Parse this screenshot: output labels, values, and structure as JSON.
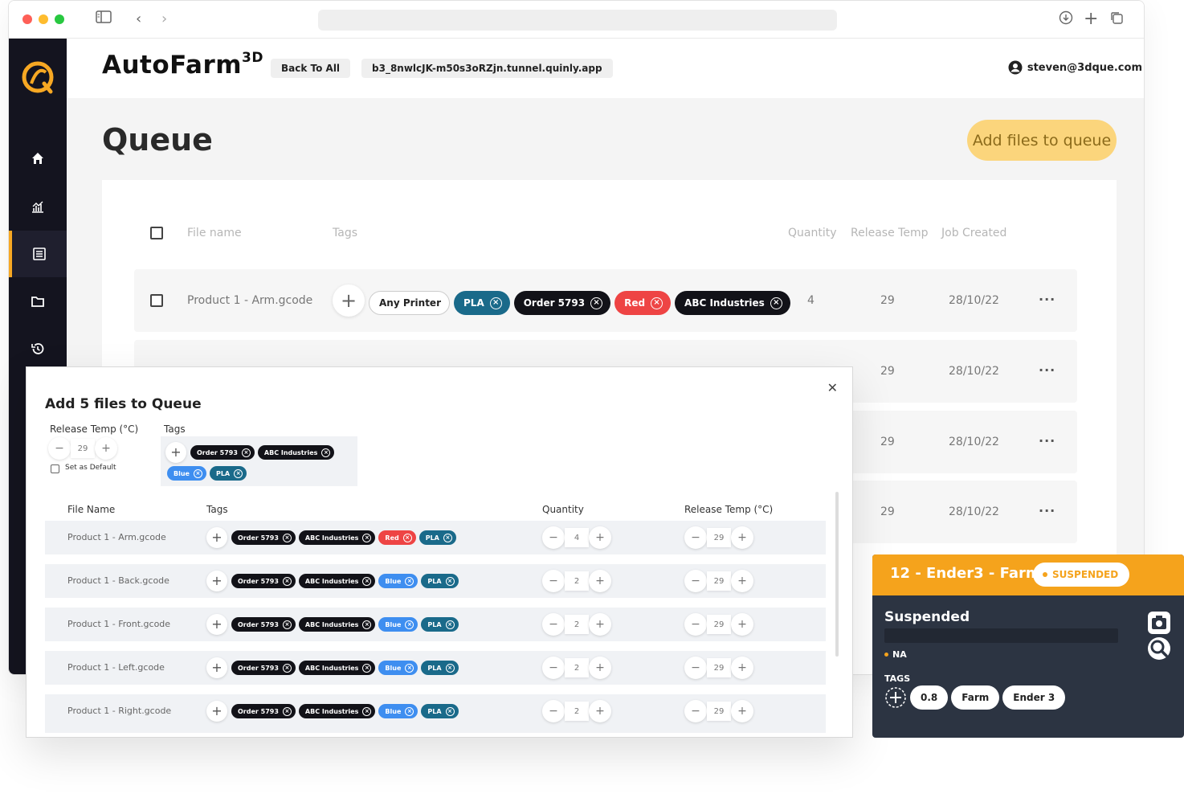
{
  "app": {
    "brand": "AutoFarm",
    "brand_sup": "3D",
    "back_label": "Back To All",
    "tunnel": "b3_8nwlcJK-m50s3oRZjn.tunnel.quinly.app",
    "user_email": "steven@3dque.com"
  },
  "queue": {
    "title": "Queue",
    "add_files_label": "Add files to queue",
    "headers": {
      "file_name": "File name",
      "tags": "Tags",
      "quantity": "Quantity",
      "release_temp": "Release Temp",
      "job_created": "Job Created"
    },
    "rows": [
      {
        "file": "Product 1 - Arm.gcode",
        "tags": [
          {
            "label": "Any Printer",
            "color": "white"
          },
          {
            "label": "PLA",
            "color": "teal"
          },
          {
            "label": "Order 5793",
            "color": "dark"
          },
          {
            "label": "Red",
            "color": "red"
          },
          {
            "label": "ABC Industries",
            "color": "dark"
          }
        ],
        "quantity": "4",
        "release_temp": "29",
        "created": "28/10/22"
      },
      {
        "release_temp": "29",
        "created": "28/10/22"
      },
      {
        "release_temp": "29",
        "created": "28/10/22"
      },
      {
        "release_temp": "29",
        "created": "28/10/22"
      }
    ]
  },
  "modal": {
    "title": "Add 5 files to Queue",
    "release_temp_label": "Release Temp (°C)",
    "release_temp_value": "29",
    "set_default_label": "Set as Default",
    "tags_label": "Tags",
    "default_tags": [
      {
        "label": "Order 5793",
        "color": "dark"
      },
      {
        "label": "ABC Industries",
        "color": "dark"
      },
      {
        "label": "Blue",
        "color": "blue"
      },
      {
        "label": "PLA",
        "color": "teal"
      }
    ],
    "headers": {
      "file_name": "File Name",
      "tags": "Tags",
      "quantity": "Quantity",
      "release_temp": "Release Temp (°C)"
    },
    "files": [
      {
        "name": "Product 1 - Arm.gcode",
        "quantity": "4",
        "temp": "29",
        "tags": [
          {
            "label": "Order 5793",
            "color": "dark"
          },
          {
            "label": "ABC Industries",
            "color": "dark"
          },
          {
            "label": "Red",
            "color": "red"
          },
          {
            "label": "PLA",
            "color": "teal"
          }
        ]
      },
      {
        "name": "Product 1 - Back.gcode",
        "quantity": "2",
        "temp": "29",
        "tags": [
          {
            "label": "Order 5793",
            "color": "dark"
          },
          {
            "label": "ABC Industries",
            "color": "dark"
          },
          {
            "label": "Blue",
            "color": "blue"
          },
          {
            "label": "PLA",
            "color": "teal"
          }
        ]
      },
      {
        "name": "Product 1 - Front.gcode",
        "quantity": "2",
        "temp": "29",
        "tags": [
          {
            "label": "Order 5793",
            "color": "dark"
          },
          {
            "label": "ABC Industries",
            "color": "dark"
          },
          {
            "label": "Blue",
            "color": "blue"
          },
          {
            "label": "PLA",
            "color": "teal"
          }
        ]
      },
      {
        "name": "Product 1 - Left.gcode",
        "quantity": "2",
        "temp": "29",
        "tags": [
          {
            "label": "Order 5793",
            "color": "dark"
          },
          {
            "label": "ABC Industries",
            "color": "dark"
          },
          {
            "label": "Blue",
            "color": "blue"
          },
          {
            "label": "PLA",
            "color": "teal"
          }
        ]
      },
      {
        "name": "Product 1 - Right.gcode",
        "quantity": "2",
        "temp": "29",
        "tags": [
          {
            "label": "Order 5793",
            "color": "dark"
          },
          {
            "label": "ABC Industries",
            "color": "dark"
          },
          {
            "label": "Blue",
            "color": "blue"
          },
          {
            "label": "PLA",
            "color": "teal"
          }
        ]
      }
    ]
  },
  "printer": {
    "title": "12 - Ender3 - Farm",
    "badge": "SUSPENDED",
    "status": "Suspended",
    "info": "NA",
    "tags_label": "TAGS",
    "tags": [
      "0.8",
      "Farm",
      "Ender 3"
    ]
  },
  "colors": {
    "accent": "#f5a31c",
    "sidebar": "#14141f",
    "tag_dark": "#121218",
    "tag_teal": "#1a6a8a",
    "tag_red": "#ee4444",
    "tag_blue": "#3e8ef0"
  },
  "icons": {
    "nav": [
      "home-icon",
      "chart-icon",
      "list-icon",
      "folder-icon",
      "history-icon"
    ],
    "card": [
      "camera-icon",
      "search-icon"
    ]
  }
}
